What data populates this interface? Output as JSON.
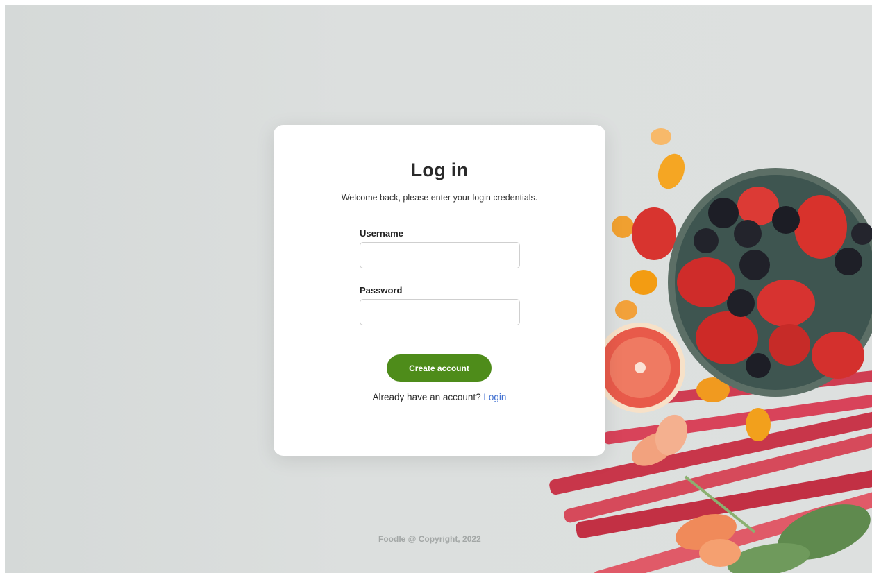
{
  "login": {
    "title": "Log in",
    "subtitle": "Welcome back, please enter your login credentials.",
    "username_label": "Username",
    "username_value": "",
    "password_label": "Password",
    "password_value": "",
    "submit_label": "Create account",
    "have_account_text": "Already have an account?",
    "login_link_label": "Login"
  },
  "footer": {
    "text": "Foodle @ Copyright, 2022"
  },
  "colors": {
    "primary_button": "#4e8c1a",
    "link": "#3f6fd0",
    "background": "#dcdfde"
  }
}
